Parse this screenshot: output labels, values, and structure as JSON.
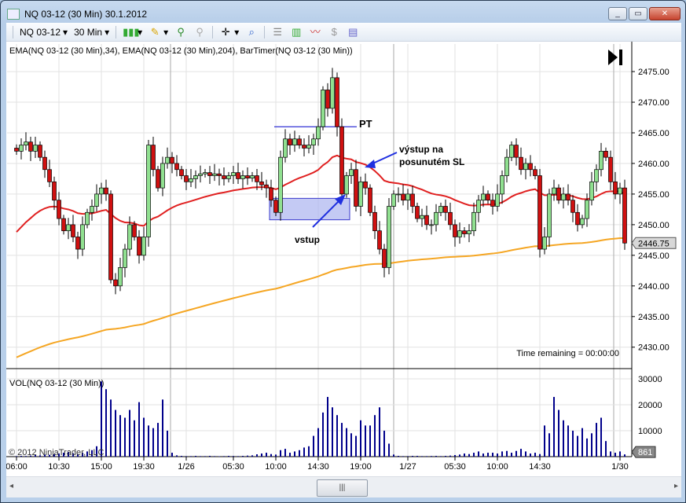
{
  "window": {
    "title": "NQ 03-12 (30 Min)  30.1.2012",
    "buttons": [
      "_",
      "▭",
      "✕"
    ]
  },
  "toolbar": {
    "instrument": "NQ 03-12",
    "interval": "30 Min",
    "icons": [
      "candlestick-icon",
      "pencil-icon",
      "zoom-in-icon",
      "zoom-out-icon",
      "crosshair-icon",
      "magnifier-icon",
      "data-box-icon",
      "chart-style-icon",
      "indicators-icon",
      "strategy-icon",
      "properties-icon"
    ]
  },
  "chart": {
    "indicator_label": "EMA(NQ 03-12 (30 Min),34), EMA(NQ 03-12 (30 Min),204), BarTimer(NQ 03-12 (30 Min))",
    "volume_label": "VOL(NQ 03-12 (30 Min))",
    "time_remaining": "Time remaining = 00:00:00",
    "copyright": "© 2012 NinjaTrader, LLC",
    "last_price": "2446.75",
    "last_volume": "861",
    "annotations": {
      "pt": "PT",
      "exit": "výstup na",
      "exit2": "posunutém SL",
      "entry": "vstup"
    },
    "colors": {
      "up": "#90e090",
      "down": "#d01010",
      "ema34": "#e02020",
      "ema204": "#f5a623",
      "volume": "#00008b",
      "pt_line": "#0000cc",
      "entry_box": "#b0b8f0"
    }
  },
  "chart_data": {
    "type": "candlestick",
    "price_ticks": [
      "2475.00",
      "2470.00",
      "2465.00",
      "2460.00",
      "2455.00",
      "2450.00",
      "2445.00",
      "2440.00",
      "2435.00",
      "2430.00"
    ],
    "price_range": [
      2426.5,
      2479.5
    ],
    "volume_ticks": [
      "30000",
      "20000",
      "10000"
    ],
    "volume_range": [
      0,
      31500
    ],
    "time_ticks": [
      "06:00",
      "10:30",
      "15:00",
      "19:30",
      "1/26",
      "05:30",
      "10:00",
      "14:30",
      "19:00",
      "1/27",
      "05:30",
      "10:00",
      "14:30",
      "1/30"
    ],
    "time_tick_bar_index": [
      0,
      9,
      18,
      27,
      36,
      46,
      55,
      64,
      73,
      83,
      93,
      102,
      111,
      128
    ],
    "ema34_seed": 2448,
    "ema204_seed": 2428,
    "pt_level": 2466,
    "closes": [
      2462,
      2463,
      2463.5,
      2462,
      2463,
      2461,
      2459,
      2457,
      2454,
      2451,
      2449,
      2450,
      2448,
      2446,
      2450,
      2452,
      2453,
      2455,
      2456,
      2455,
      2441,
      2440,
      2443,
      2446,
      2450,
      2448,
      2445,
      2448,
      2463,
      2459,
      2456,
      2460,
      2461,
      2460,
      2459,
      2458,
      2457,
      2457.5,
      2458,
      2458.3,
      2458.5,
      2458,
      2458.3,
      2458,
      2457.5,
      2458,
      2458.5,
      2457.5,
      2458,
      2457.6,
      2458,
      2457,
      2456.5,
      2456,
      2454,
      2452,
      2461,
      2464,
      2463,
      2464,
      2463,
      2462.5,
      2463,
      2464,
      2466,
      2472,
      2469,
      2474,
      2466,
      2455,
      2458,
      2459,
      2453,
      2457,
      2456,
      2452,
      2449,
      2446,
      2443,
      2453,
      2455,
      2455,
      2454,
      2455,
      2453,
      2451,
      2451.5,
      2450,
      2450,
      2452,
      2453,
      2452,
      2450,
      2448,
      2449,
      2448.5,
      2449,
      2452,
      2454,
      2455,
      2454,
      2453,
      2455,
      2458,
      2461,
      2463,
      2461,
      2459,
      2460,
      2459,
      2458,
      2446,
      2448,
      2455,
      2456,
      2454,
      2455,
      2454,
      2452,
      2450,
      2451,
      2454,
      2457,
      2459,
      2462,
      2461,
      2457,
      2455,
      2456,
      2447
    ],
    "volumes": [
      200,
      300,
      250,
      400,
      600,
      500,
      800,
      700,
      900,
      1200,
      1500,
      1800,
      1300,
      1000,
      1500,
      2000,
      2500,
      4000,
      29000,
      26000,
      22000,
      18000,
      16000,
      15000,
      18000,
      14000,
      21000,
      15000,
      12000,
      11000,
      13000,
      22000,
      10000,
      1500,
      500,
      300,
      200,
      200,
      300,
      200,
      200,
      300,
      200,
      150,
      200,
      300,
      250,
      200,
      300,
      400,
      500,
      900,
      1200,
      1500,
      1000,
      800,
      2500,
      3000,
      1500,
      2000,
      2500,
      3500,
      4000,
      8000,
      11000,
      17000,
      23000,
      19000,
      16000,
      13000,
      11000,
      9000,
      8000,
      14000,
      12000,
      12000,
      16000,
      19000,
      10000,
      5000,
      800,
      300,
      200,
      200,
      300,
      300,
      200,
      200,
      250,
      300,
      200,
      300,
      400,
      600,
      800,
      1200,
      1000,
      1500,
      2000,
      1200,
      1500,
      1500,
      1200,
      2000,
      2200,
      1500,
      2200,
      3000,
      2000,
      1200,
      1500,
      1000,
      12000,
      9000,
      23000,
      18000,
      14000,
      12000,
      10000,
      8000,
      11000,
      7000,
      9000,
      13000,
      15000,
      6000,
      2000,
      1500,
      2000,
      861
    ]
  }
}
